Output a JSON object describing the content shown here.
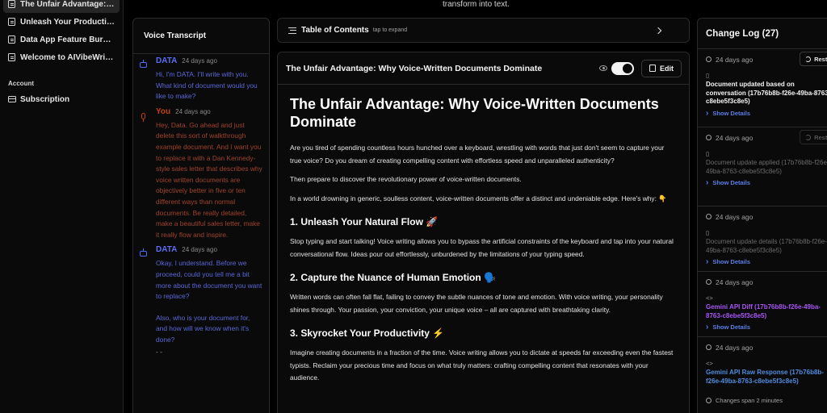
{
  "sidebar": {
    "docs": [
      {
        "label": "The Unfair Advantage: ...",
        "active": true
      },
      {
        "label": "Unleash Your Productivit...",
        "active": false
      },
      {
        "label": "Data App Feature Burndo...",
        "active": false
      },
      {
        "label": "Welcome to AIVibeWriter...",
        "active": false
      }
    ],
    "account_title": "Account",
    "subscription_label": "Subscription"
  },
  "top_text": "transform into text.",
  "voice": {
    "title": "Voice Transcript",
    "messages": [
      {
        "speaker": "DATA",
        "time": "24 days ago",
        "text": "Hi, I'm DATA. I'll write with you. What kind of document would you like to make?"
      },
      {
        "speaker": "You",
        "time": "24 days ago",
        "text": "Hey, Data. Go ahead and just delete this sort of walkthrough example document. And I want you to replace it with a Dan Kennedy-style sales letter that describes why voice written documents are objectively better in five or ten different ways than normal documents. Be really detailed, make a beautiful sales letter, make it really flow and inspire."
      },
      {
        "speaker": "DATA",
        "time": "24 days ago",
        "text": "Okay, I understand. Before we proceed, could you tell me a bit more about the document you want to replace?",
        "text2": "Also, who is your document for, and how will we know when it's done?",
        "text3": "- -"
      }
    ]
  },
  "toc": {
    "title": "Table of Contents",
    "hint": "tap to expand"
  },
  "doc": {
    "header_title": "The Unfair Advantage: Why Voice-Written Documents Dominate",
    "edit_label": "Edit",
    "h1": "The Unfair Advantage: Why Voice-Written Documents Dominate",
    "p1": "Are you tired of spending countless hours hunched over a keyboard, wrestling with words that just don't seem to capture your true voice? Do you dream of creating compelling content with effortless speed and unparalleled authenticity?",
    "p2": "Then prepare to discover the revolutionary power of voice-written documents.",
    "p3": "In a world drowning in generic, soulless content, voice-written documents offer a distinct and undeniable edge. Here's why: 👇",
    "s1_title": "1. Unleash Your Natural Flow 🚀",
    "s1_text": "Stop typing and start talking! Voice writing allows you to bypass the artificial constraints of the keyboard and tap into your natural conversational flow. Ideas pour out effortlessly, unburdened by the limitations of your typing speed.",
    "s2_title": "2. Capture the Nuance of Human Emotion 🗣️",
    "s2_text": "Written words can often fall flat, failing to convey the subtle nuances of tone and emotion. With voice writing, your personality shines through. Your passion, your conviction, your unique voice – all are captured with breathtaking clarity.",
    "s3_title": "3. Skyrocket Your Productivity ⚡",
    "s3_text": "Imagine creating documents in a fraction of the time. Voice writing allows you to dictate at speeds far exceeding even the fastest typists. Reclaim your precious time and focus on what truly matters: crafting compelling content that resonates with your audience."
  },
  "changelog": {
    "title": "Change Log (27)",
    "restore_label": "Restore",
    "show_details": "Show Details",
    "entries": [
      {
        "time": "24 days ago",
        "kind": "📄",
        "text": "Document updated based on conversation (17b76b8b-f26e-49ba-8763-c8ebe5f3c8e5)",
        "restore": true
      },
      {
        "time": "24 days ago",
        "kind": "📄",
        "text": "Document update applied (17b76b8b-f26e-49ba-8763-c8ebe5f3c8e5)",
        "restore_dim": true
      },
      {
        "time": "24 days ago",
        "kind": "📄",
        "text": "Document update details (17b76b8b-f26e-49ba-8763-c8ebe5f3c8e5)"
      },
      {
        "time": "24 days ago",
        "kind": "<>",
        "text": "Gemini API Diff (17b76b8b-f26e-49ba-8763-c8ebe5f3c8e5)"
      },
      {
        "time": "24 days ago",
        "kind": "<>",
        "text": "Gemini API Raw Response (17b76b8b-f26e-49ba-8763-c8ebe5f3c8e5)"
      }
    ],
    "footer": "Changes span 2 minutes"
  },
  "colors": {
    "data_speaker": "#5b6ef5",
    "user_speaker": "#c2410c",
    "diff": "#a855f7",
    "raw": "#4f8de0",
    "link": "#5b7fe8"
  }
}
